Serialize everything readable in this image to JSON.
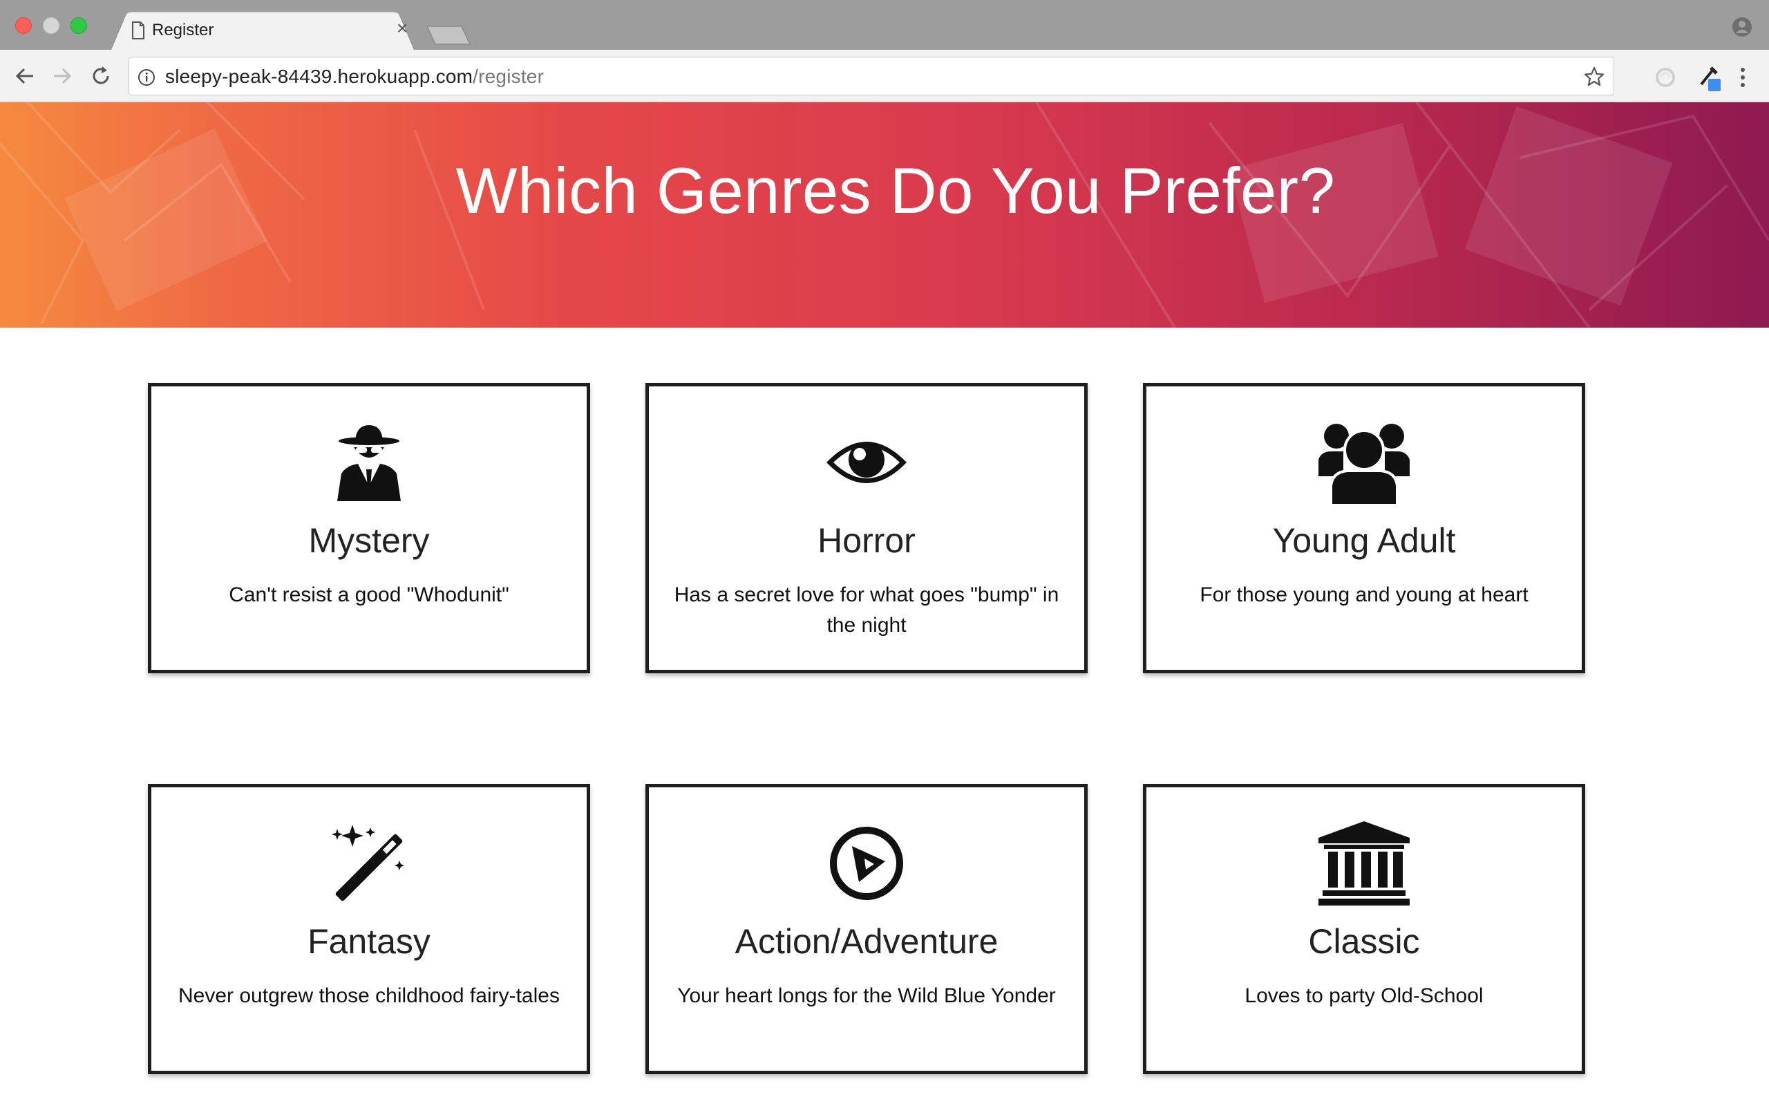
{
  "browser": {
    "tab_title": "Register",
    "tab_close": "×",
    "url_host": "sleepy-peak-84439.herokuapp.com",
    "url_path": "/register"
  },
  "hero": {
    "title": "Which Genres Do You Prefer?"
  },
  "genres": [
    {
      "name": "Mystery",
      "description": "Can't resist a good \"Whodunit\"",
      "icon": "spy-icon"
    },
    {
      "name": "Horror",
      "description": "Has a secret love for what goes \"bump\" in the night",
      "icon": "eye-icon"
    },
    {
      "name": "Young Adult",
      "description": "For those young and young at heart",
      "icon": "users-icon"
    },
    {
      "name": "Fantasy",
      "description": "Never outgrew those childhood fairy-tales",
      "icon": "magic-wand-icon"
    },
    {
      "name": "Action/Adventure",
      "description": "Your heart longs for the Wild Blue Yonder",
      "icon": "compass-icon"
    },
    {
      "name": "Classic",
      "description": "Loves to party Old-School",
      "icon": "bank-icon"
    }
  ],
  "colors": {
    "hero_start": "#f58a3e",
    "hero_mid": "#e54848",
    "hero_end": "#8e1a4f",
    "card_border": "#1e1e1e"
  }
}
